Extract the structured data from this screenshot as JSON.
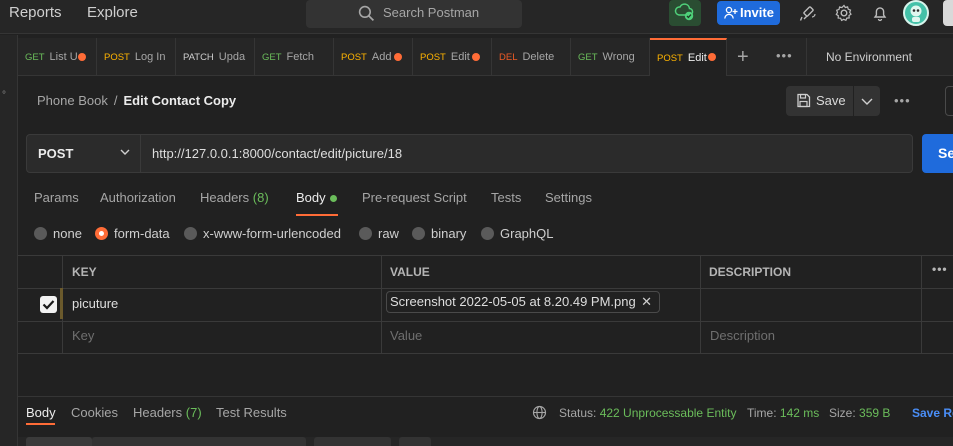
{
  "topbar": {
    "reports": "Reports",
    "explore": "Explore",
    "search_placeholder": "Search Postman",
    "invite": "Invite"
  },
  "tabs": [
    {
      "method": "GET",
      "name": "List U",
      "dot": true
    },
    {
      "method": "POST",
      "name": "Log In",
      "dot": false
    },
    {
      "method": "PATCH",
      "name": "Upda",
      "dot": false
    },
    {
      "method": "GET",
      "name": "Fetch",
      "dot": false
    },
    {
      "method": "POST",
      "name": "Add",
      "dot": true
    },
    {
      "method": "POST",
      "name": "Edit",
      "dot": true
    },
    {
      "method": "DEL",
      "name": "Delete",
      "dot": false
    },
    {
      "method": "GET",
      "name": "Wrong",
      "dot": false
    },
    {
      "method": "POST",
      "name": "Edit",
      "dot": true,
      "active": true
    }
  ],
  "environment": "No Environment",
  "breadcrumb": {
    "collection": "Phone Book",
    "separator": "/",
    "request": "Edit Contact Copy"
  },
  "save_label": "Save",
  "request": {
    "method": "POST",
    "url": "http://127.0.0.1:8000/contact/edit/picture/18",
    "send_label": "Se"
  },
  "request_tabs": {
    "params": "Params",
    "authorization": "Authorization",
    "headers": "Headers",
    "headers_count": "(8)",
    "body": "Body",
    "prerequest": "Pre-request Script",
    "tests": "Tests",
    "settings": "Settings"
  },
  "body_modes": {
    "none": "none",
    "form_data": "form-data",
    "urlencoded": "x-www-form-urlencoded",
    "raw": "raw",
    "binary": "binary",
    "graphql": "GraphQL",
    "selected": "form-data"
  },
  "table": {
    "headers": {
      "key": "KEY",
      "value": "VALUE",
      "description": "DESCRIPTION"
    },
    "rows": [
      {
        "checked": true,
        "key": "picuture",
        "value": "Screenshot 2022-05-05 at 8.20.49 PM.png"
      }
    ],
    "placeholder": {
      "key": "Key",
      "value": "Value",
      "description": "Description"
    }
  },
  "response": {
    "tabs": {
      "body": "Body",
      "cookies": "Cookies",
      "headers": "Headers",
      "headers_count": "(7)",
      "test_results": "Test Results"
    },
    "status_label": "Status:",
    "status_value": "422 Unprocessable Entity",
    "time_label": "Time:",
    "time_value": "142 ms",
    "size_label": "Size:",
    "size_value": "359 B",
    "save_response": "Save Re"
  },
  "colors": {
    "accent": "#ff6c37",
    "primary": "#1f6bdc",
    "success": "#6bbd5b",
    "post": "#ffb400",
    "delete": "#ef5b25"
  }
}
